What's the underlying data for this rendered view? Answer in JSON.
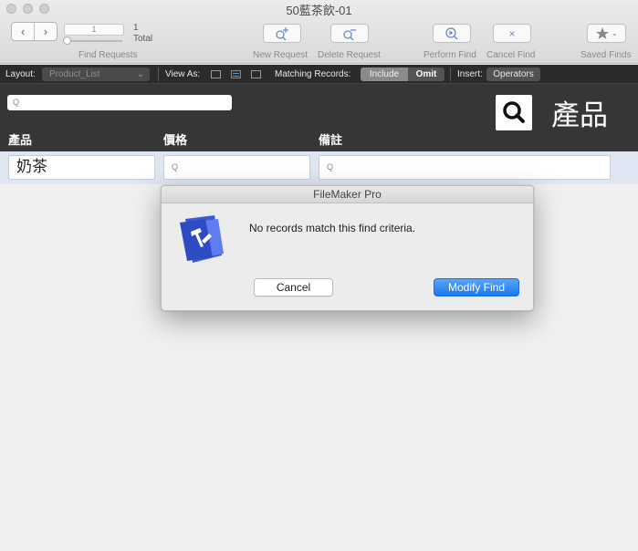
{
  "window": {
    "title": "50藍茶飲-01"
  },
  "toolbar": {
    "record_field": "1",
    "found_count": "1",
    "total_label": "Total",
    "find_requests_label": "Find Requests",
    "new_request_label": "New Request",
    "delete_request_label": "Delete Request",
    "perform_find_label": "Perform Find",
    "cancel_find_label": "Cancel Find",
    "saved_finds_label": "Saved Finds"
  },
  "layout_bar": {
    "layout_label": "Layout:",
    "layout_value": "Product_List",
    "view_as_label": "View As:",
    "matching_records_label": "Matching Records:",
    "include_label": "Include",
    "omit_label": "Omit",
    "insert_label": "Insert:",
    "operators_label": "Operators"
  },
  "header": {
    "search_placeholder": "Q",
    "title": "產品",
    "columns": [
      "產品",
      "價格",
      "備註"
    ]
  },
  "row": {
    "product_value": "奶茶",
    "price_placeholder": "Q",
    "note_placeholder": "Q"
  },
  "dialog": {
    "title": "FileMaker Pro",
    "message": "No records match this find criteria.",
    "cancel_label": "Cancel",
    "modify_label": "Modify Find"
  },
  "colors": {
    "accent": "#1878f2",
    "header_bg": "#363636",
    "row_bg": "#dfe6f3"
  }
}
